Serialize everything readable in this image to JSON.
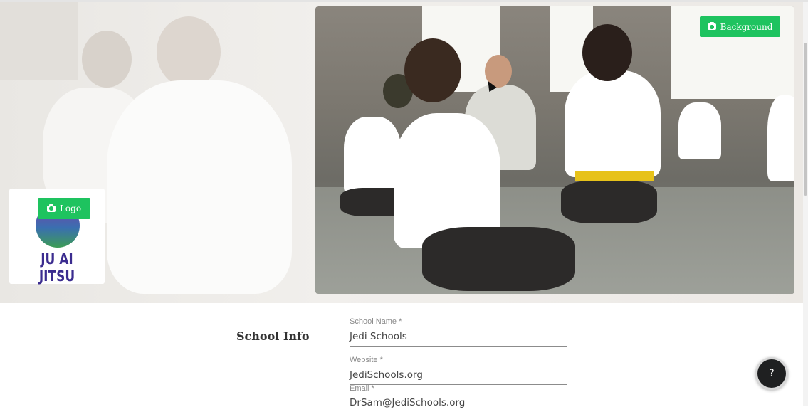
{
  "hero": {
    "background_button_label": "Background",
    "background_button_icon": "camera-icon",
    "logo_button_label": "Logo",
    "logo_button_icon": "camera-icon",
    "logo_text": "JU AI JITSU"
  },
  "school_info": {
    "section_title": "School Info",
    "fields": [
      {
        "label": "School Name *",
        "value": "Jedi Schools"
      },
      {
        "label": "Website *",
        "value": "JediSchools.org"
      },
      {
        "label": "Email *",
        "value": "DrSam@JediSchools.org"
      }
    ]
  },
  "help": {
    "label": "?"
  },
  "colors": {
    "accent": "#1ec35f",
    "help_button": "#1f2021",
    "logo_text": "#3b2c8f"
  }
}
